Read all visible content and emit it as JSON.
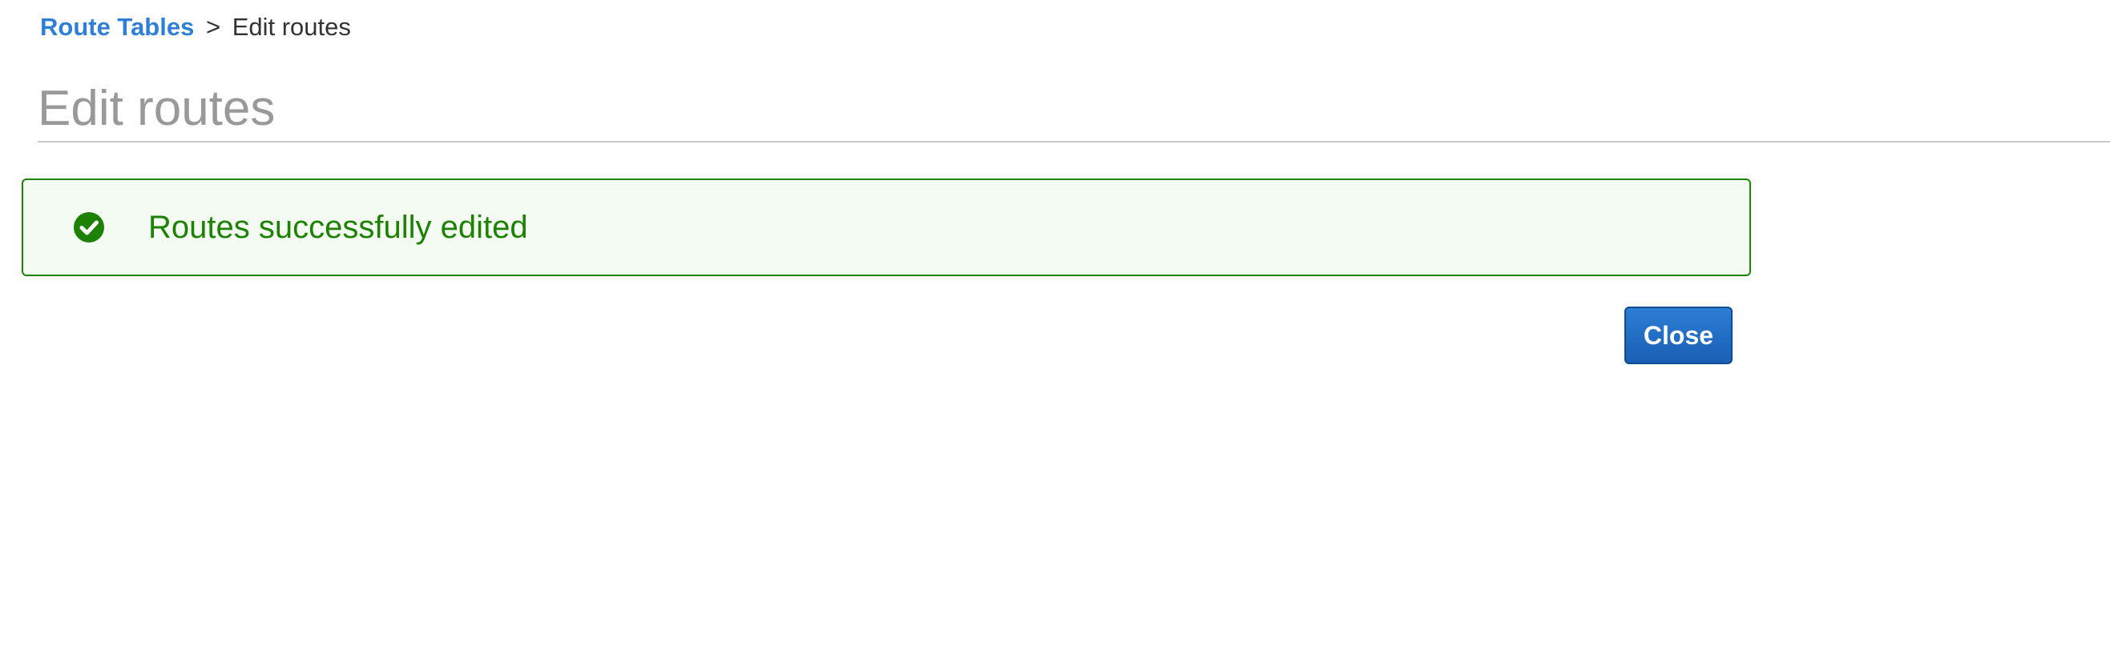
{
  "breadcrumb": {
    "parent_label": "Route Tables",
    "separator": ">",
    "current_label": "Edit routes"
  },
  "page": {
    "title": "Edit routes"
  },
  "alert": {
    "icon": "check-circle-icon",
    "message": "Routes successfully edited",
    "color": "#1d8102",
    "background": "#f4fbf3"
  },
  "actions": {
    "close_label": "Close",
    "primary_color": "#1f6fcc"
  },
  "colors": {
    "link": "#2f7fd6",
    "title": "#999999"
  }
}
